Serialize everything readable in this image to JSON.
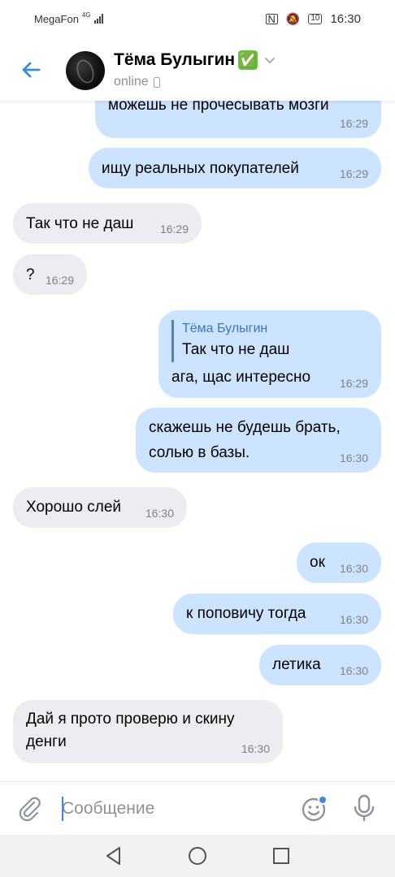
{
  "status_bar": {
    "carrier": "MegaFon",
    "network": "4G",
    "battery": "10",
    "time": "16:30"
  },
  "header": {
    "contact_name": "Тёма Булыгин",
    "verified_emoji": "✅",
    "status": "online"
  },
  "messages": [
    {
      "direction": "out",
      "text": "можешь не прочесывать мозги",
      "time": "16:29"
    },
    {
      "direction": "out",
      "text": "ищу реальных покупателей",
      "time": "16:29"
    },
    {
      "direction": "in",
      "text": "Так что не даш",
      "time": "16:29"
    },
    {
      "direction": "in",
      "text": "?",
      "time": "16:29"
    },
    {
      "direction": "out",
      "reply_name": "Тёма Булыгин",
      "reply_text": "Так что не даш",
      "text": "ага, щас интересно",
      "time": "16:29"
    },
    {
      "direction": "out",
      "text_line1": "скажешь не будешь брать,",
      "text_line2": "солью в базы.",
      "time": "16:30"
    },
    {
      "direction": "in",
      "text": "Хорошо слей",
      "time": "16:30"
    },
    {
      "direction": "out",
      "text": "ок",
      "time": "16:30"
    },
    {
      "direction": "out",
      "text": "к поповичу тогда",
      "time": "16:30"
    },
    {
      "direction": "out",
      "text": "летика",
      "time": "16:30"
    },
    {
      "direction": "in",
      "text_line1": "Дай я прото проверю и скину",
      "text_line2": "денги",
      "time": "16:30"
    }
  ],
  "composer": {
    "placeholder": "Сообщение"
  },
  "icons": {
    "back": "arrow-left-icon",
    "attach": "paperclip-icon",
    "emoji": "smile-icon",
    "mic": "microphone-icon",
    "nav_back": "triangle-back-icon",
    "nav_home": "circle-home-icon",
    "nav_recent": "square-recent-icon"
  },
  "colors": {
    "outgoing_bubble": "#cce4ff",
    "incoming_bubble": "#ebedf0",
    "accent": "#3f8ae0",
    "verified": "#64c43d"
  }
}
